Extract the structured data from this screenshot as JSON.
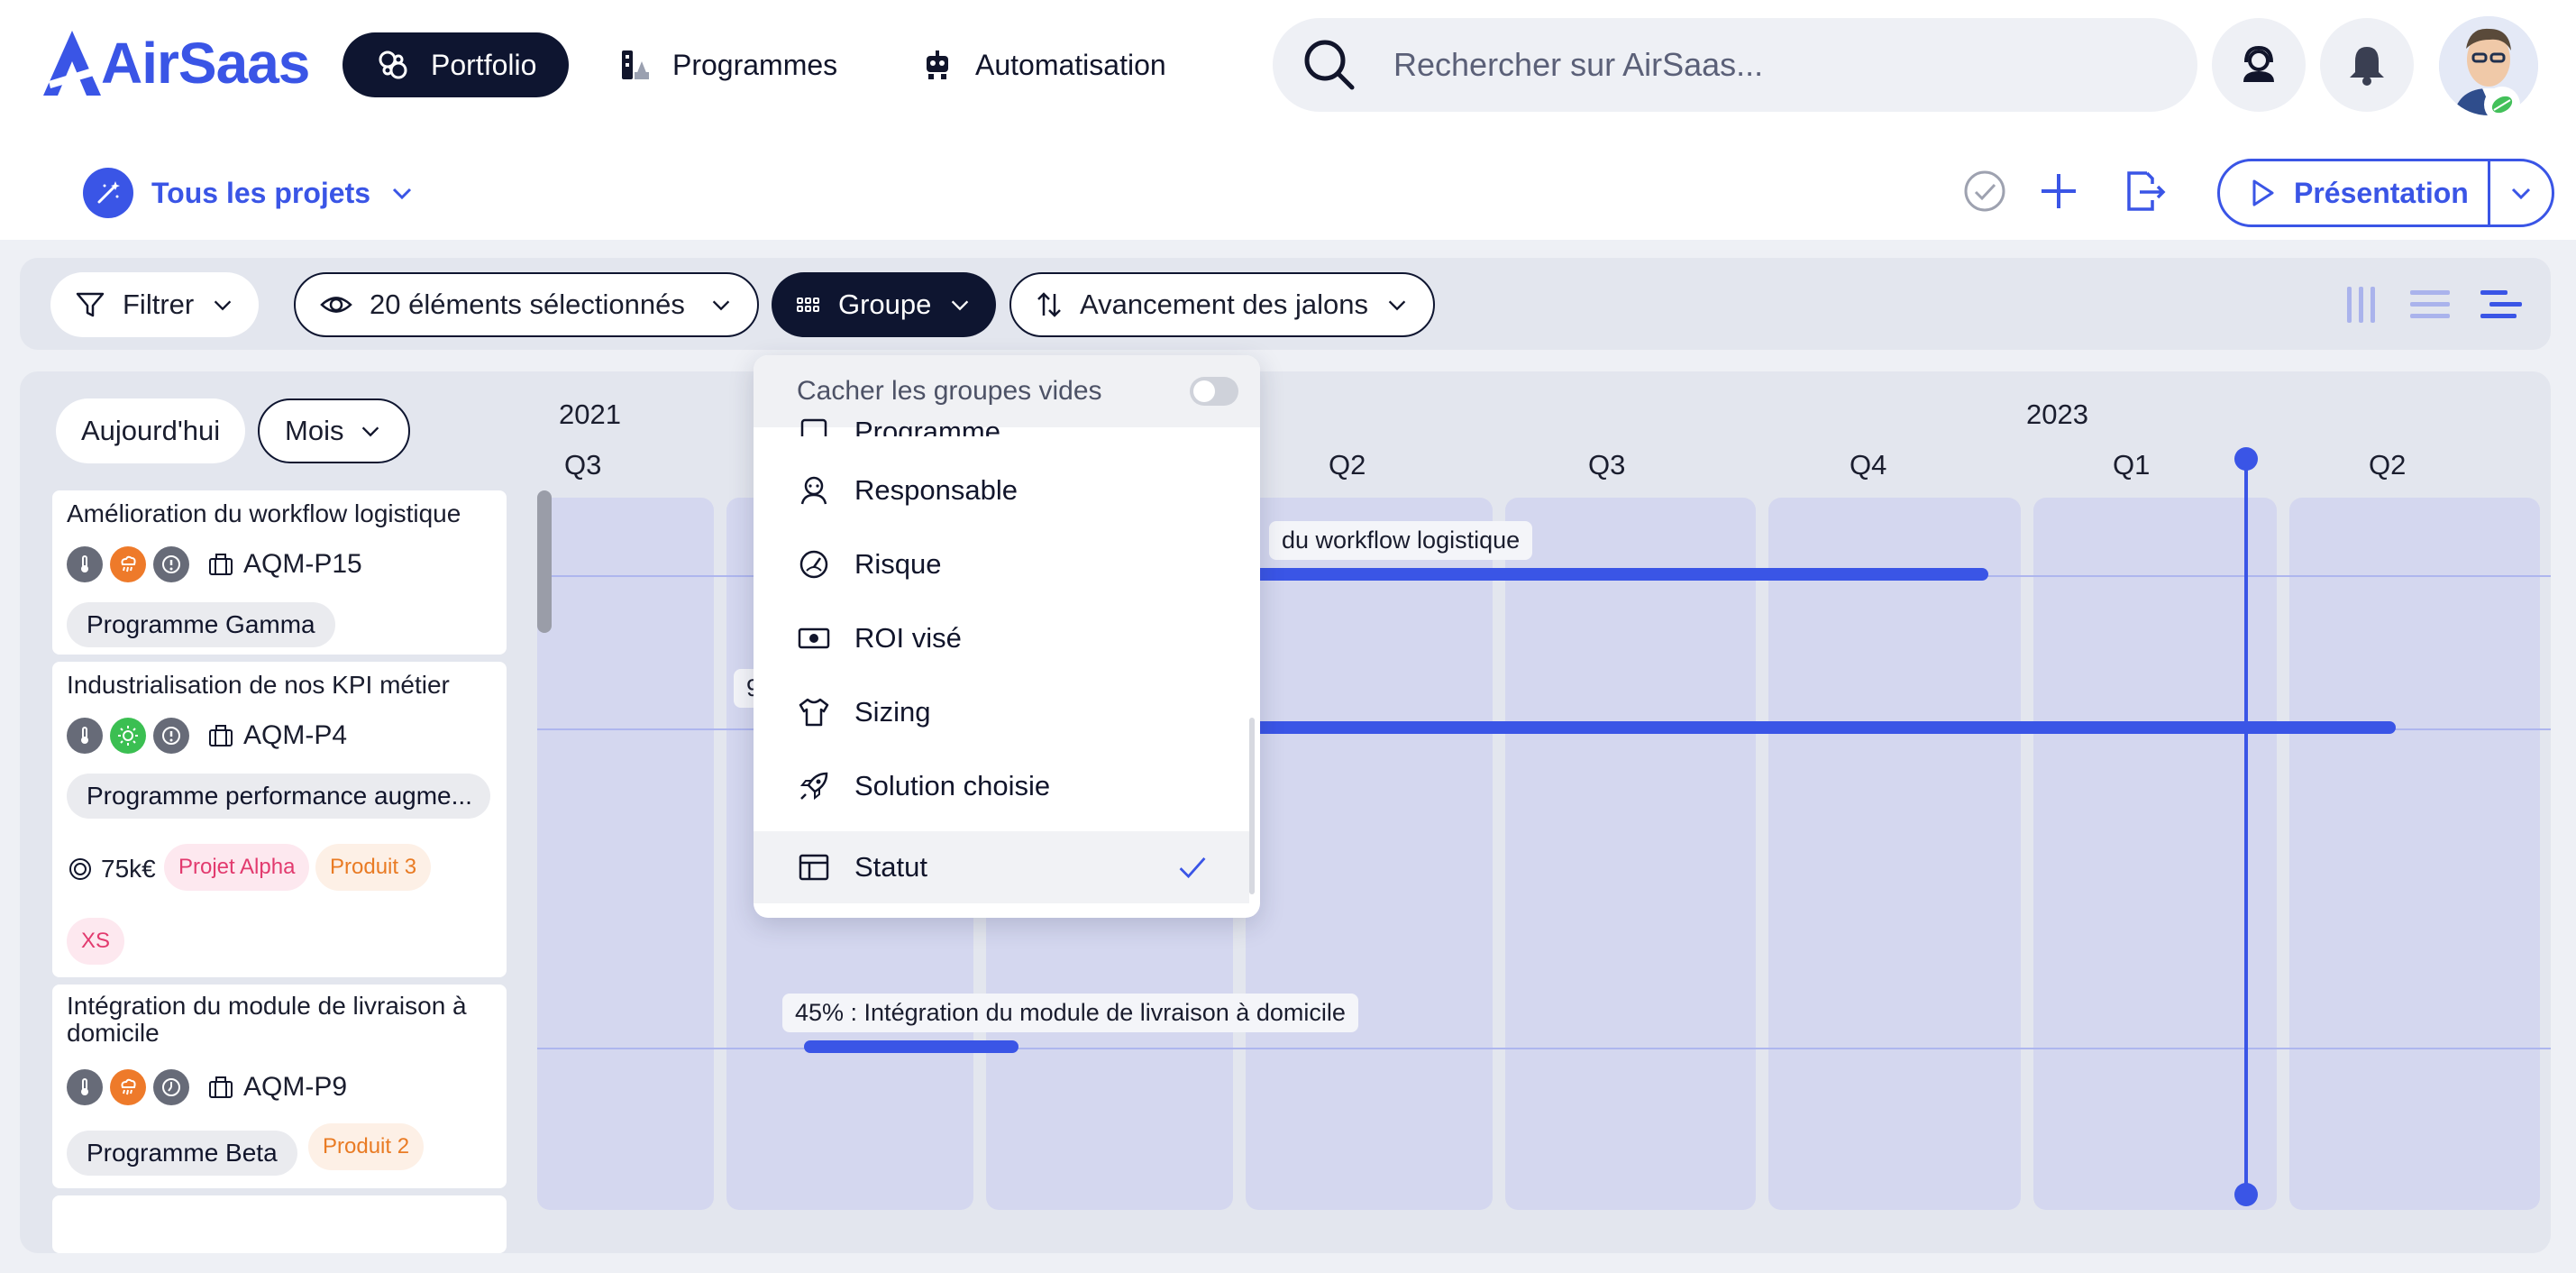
{
  "app": {
    "brand": "AirSaas",
    "brand_color": "#3a55e6"
  },
  "topnav": {
    "items": [
      {
        "label": "Portfolio",
        "icon": "portfolio-icon",
        "active": true
      },
      {
        "label": "Programmes",
        "icon": "programmes-icon",
        "active": false
      },
      {
        "label": "Automatisation",
        "icon": "robot-icon",
        "active": false
      }
    ],
    "search_placeholder": "Rechercher sur AirSaas..."
  },
  "subheader": {
    "project_selector": "Tous les projets",
    "presentation_label": "Présentation"
  },
  "filterbar": {
    "filter_label": "Filtrer",
    "visible_label": "20 éléments sélectionnés",
    "group_label": "Groupe",
    "sort_label": "Avancement des jalons"
  },
  "timeline": {
    "today_label": "Aujourd'hui",
    "scale_label": "Mois",
    "years": [
      "2021",
      "2023"
    ],
    "quarters": [
      "Q3",
      "Q2",
      "Q3",
      "Q4",
      "Q1",
      "Q2"
    ],
    "bar_labels": [
      "du workflow logistique",
      "9",
      "45% : Intégration du module de livraison à domicile"
    ]
  },
  "projects": [
    {
      "title": "Amélioration du workflow logistique",
      "code": "AQM-P15",
      "programme": "Programme Gamma"
    },
    {
      "title": "Industrialisation de nos KPI métier",
      "code": "AQM-P4",
      "programme": "Programme performance augme...",
      "budget": "75k€",
      "tags": [
        "Projet Alpha",
        "Produit 3",
        "XS"
      ]
    },
    {
      "title_line1": "Intégration du module de livraison à",
      "title_line2": "domicile",
      "code": "AQM-P9",
      "programme": "Programme Beta",
      "tags": [
        "Produit 2"
      ]
    }
  ],
  "group_dropdown": {
    "hide_empty_label": "Cacher les groupes vides",
    "hide_empty_on": false,
    "options": [
      {
        "label": "Programme",
        "icon": "programme-icon"
      },
      {
        "label": "Responsable",
        "icon": "person-icon"
      },
      {
        "label": "Risque",
        "icon": "gauge-icon"
      },
      {
        "label": "ROI visé",
        "icon": "money-icon"
      },
      {
        "label": "Sizing",
        "icon": "tshirt-icon"
      },
      {
        "label": "Solution choisie",
        "icon": "rocket-icon"
      },
      {
        "label": "Statut",
        "icon": "layout-icon",
        "selected": true
      }
    ]
  }
}
